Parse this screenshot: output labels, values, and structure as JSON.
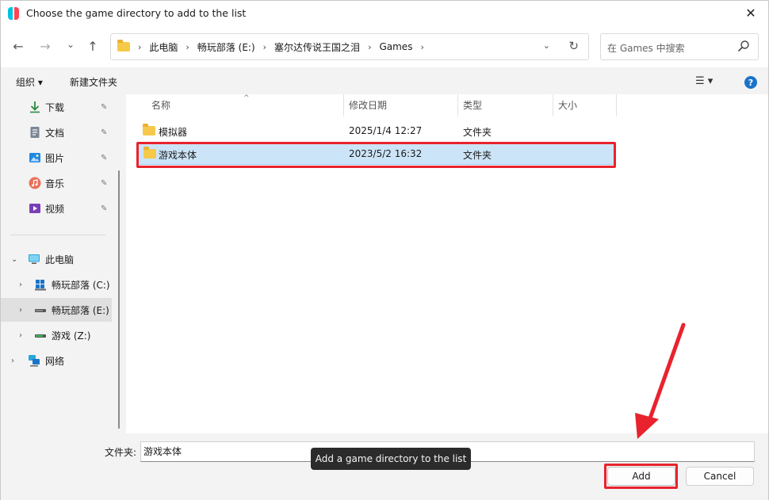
{
  "window": {
    "title": "Choose the game directory to add to the list",
    "close_glyph": "✕"
  },
  "nav": {
    "back_glyph": "←",
    "forward_glyph": "→",
    "recent_glyph": "⌄",
    "up_glyph": "↑",
    "breadcrumbs": [
      "此电脑",
      "畅玩部落 (E:)",
      "塞尔达传说王国之泪",
      "Games"
    ],
    "crumb_sep": "›",
    "dropdown_glyph": "⌄",
    "refresh_glyph": "↻",
    "search_placeholder": "在 Games 中搜索"
  },
  "toolbar": {
    "organize": "组织 ▾",
    "new_folder": "新建文件夹",
    "view_glyph": "☰ ▾",
    "help_glyph": "?"
  },
  "sidebar": {
    "quick": [
      {
        "label": "下载",
        "icon": "download-icon"
      },
      {
        "label": "文档",
        "icon": "document-icon"
      },
      {
        "label": "图片",
        "icon": "picture-icon"
      },
      {
        "label": "音乐",
        "icon": "music-icon"
      },
      {
        "label": "视频",
        "icon": "video-icon"
      }
    ],
    "pin_glyph": "📌",
    "this_pc": "此电脑",
    "drives": [
      {
        "label": "畅玩部落 (C:)"
      },
      {
        "label": "畅玩部落 (E:)"
      },
      {
        "label": "游戏 (Z:)"
      }
    ],
    "network": "网络",
    "expand_glyph": "›",
    "expanded_glyph": "⌄"
  },
  "filelist": {
    "columns": [
      "名称",
      "修改日期",
      "类型",
      "大小"
    ],
    "sort_glyph": "^",
    "rows": [
      {
        "name": "模拟器",
        "modified": "2025/1/4 12:27",
        "type": "文件夹",
        "size": ""
      },
      {
        "name": "游戏本体",
        "modified": "2023/5/2 16:32",
        "type": "文件夹",
        "size": ""
      }
    ],
    "selected_index": 1
  },
  "footer": {
    "folder_label": "文件夹:",
    "folder_value": "游戏本体",
    "tooltip": "Add a game directory to the list",
    "add_label": "Add",
    "cancel_label": "Cancel"
  },
  "colors": {
    "accent_highlight": "#e8232e",
    "selection_bg": "#cce4f7",
    "folder": "#f6c94b"
  }
}
